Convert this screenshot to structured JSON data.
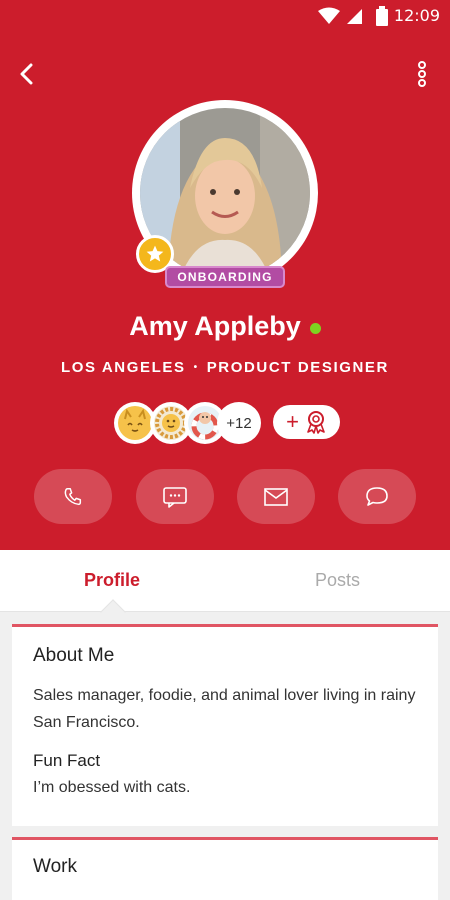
{
  "status_bar": {
    "time": "12:09"
  },
  "profile": {
    "name": "Amy Appleby",
    "badge": "ONBOARDING",
    "location": "LOS ANGELES",
    "role": "PRODUCT DESIGNER",
    "separator": "•",
    "online_color": "#7ed321"
  },
  "badges": {
    "more_count": "+12",
    "add_label": "+"
  },
  "actions": [
    "phone-icon",
    "sms-icon",
    "mail-icon",
    "chat-icon"
  ],
  "tabs": [
    {
      "label": "Profile",
      "active": true
    },
    {
      "label": "Posts",
      "active": false
    }
  ],
  "about": {
    "title": "About Me",
    "text": "Sales manager, foodie, and animal lover living in rainy San Francisco.",
    "fun_fact_title": "Fun Fact",
    "fun_fact_text": "I’m obessed with cats."
  },
  "work": {
    "title": "Work"
  },
  "colors": {
    "brand": "#cc1d2c",
    "badge_purple": "#b24ca3",
    "star": "#f4b71c"
  }
}
